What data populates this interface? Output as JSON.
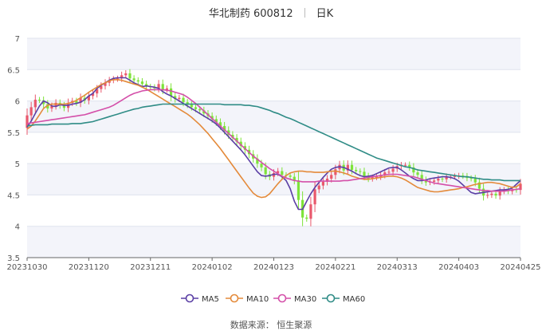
{
  "title": {
    "name": "华北制药 600812",
    "period": "日K"
  },
  "source": "数据来源： 恒生聚源",
  "colors": {
    "up": "#e9586c",
    "down": "#7ee33a",
    "MA5": "#5b3fa5",
    "MA10": "#e48a3a",
    "MA30": "#d44fa9",
    "MA60": "#2f8c86",
    "band": "#f3f4fa",
    "grid": "#dfe3ee"
  },
  "chart_data": {
    "type": "candlestick",
    "ylim": [
      3.5,
      7
    ],
    "yticks": [
      "3.5",
      "4",
      "4.5",
      "5",
      "5.5",
      "6",
      "6.5",
      "7"
    ],
    "xtick_labels": [
      "20231030",
      "20231120",
      "20231211",
      "20240102",
      "20240123",
      "20240221",
      "20240313",
      "20240403",
      "20240425"
    ],
    "xtick_index": [
      0,
      15,
      30,
      45,
      60,
      75,
      90,
      105,
      120
    ],
    "legend": [
      "MA5",
      "MA10",
      "MA30",
      "MA60"
    ],
    "legend_position": "bottom",
    "closes": [
      5.77,
      5.9,
      6.02,
      6.01,
      5.95,
      5.88,
      5.92,
      5.97,
      5.93,
      5.89,
      5.97,
      6.0,
      5.97,
      6.05,
      6.01,
      6.08,
      6.12,
      6.19,
      6.24,
      6.29,
      6.33,
      6.35,
      6.36,
      6.41,
      6.44,
      6.36,
      6.33,
      6.31,
      6.27,
      6.23,
      6.22,
      6.2,
      6.27,
      6.18,
      6.2,
      6.08,
      6.03,
      6.05,
      5.98,
      5.94,
      5.9,
      5.87,
      5.85,
      5.8,
      5.76,
      5.71,
      5.66,
      5.6,
      5.53,
      5.46,
      5.41,
      5.35,
      5.28,
      5.22,
      5.15,
      5.08,
      5.0,
      4.94,
      4.83,
      4.79,
      4.85,
      4.88,
      4.82,
      4.81,
      4.79,
      4.73,
      4.42,
      4.14,
      4.12,
      4.35,
      4.59,
      4.65,
      4.71,
      4.76,
      4.82,
      4.91,
      4.98,
      4.89,
      4.98,
      4.9,
      4.88,
      4.87,
      4.8,
      4.76,
      4.78,
      4.79,
      4.82,
      4.86,
      4.87,
      4.92,
      4.96,
      4.98,
      4.98,
      4.94,
      4.86,
      4.82,
      4.74,
      4.7,
      4.71,
      4.73,
      4.76,
      4.75,
      4.79,
      4.79,
      4.8,
      4.81,
      4.8,
      4.77,
      4.76,
      4.7,
      4.6,
      4.49,
      4.5,
      4.52,
      4.49,
      4.56,
      4.58,
      4.56,
      4.59,
      4.58,
      4.68
    ],
    "ma_series": [
      {
        "name": "MA5",
        "values": [
          5.58,
          5.68,
          5.8,
          5.92,
          6.0,
          5.97,
          5.92,
          5.91,
          5.94,
          5.93,
          5.93,
          5.95,
          5.96,
          5.98,
          6.02,
          6.08,
          6.12,
          6.2,
          6.25,
          6.29,
          6.33,
          6.36,
          6.37,
          6.37,
          6.37,
          6.33,
          6.29,
          6.26,
          6.23,
          6.24,
          6.23,
          6.22,
          6.2,
          6.15,
          6.11,
          6.08,
          6.04,
          6.0,
          5.96,
          5.92,
          5.88,
          5.84,
          5.8,
          5.76,
          5.72,
          5.68,
          5.63,
          5.57,
          5.5,
          5.43,
          5.36,
          5.29,
          5.22,
          5.14,
          5.05,
          4.96,
          4.87,
          4.81,
          4.8,
          4.81,
          4.83,
          4.83,
          4.79,
          4.73,
          4.6,
          4.4,
          4.27,
          4.27,
          4.4,
          4.52,
          4.62,
          4.7,
          4.78,
          4.85,
          4.91,
          4.94,
          4.95,
          4.94,
          4.91,
          4.88,
          4.84,
          4.81,
          4.79,
          4.8,
          4.81,
          4.84,
          4.87,
          4.9,
          4.93,
          4.94,
          4.94,
          4.9,
          4.85,
          4.8,
          4.76,
          4.73,
          4.73,
          4.74,
          4.76,
          4.77,
          4.78,
          4.79,
          4.79,
          4.78,
          4.76,
          4.72,
          4.66,
          4.6,
          4.54,
          4.52,
          4.53,
          4.54,
          4.55,
          4.56,
          4.57,
          4.58,
          4.58,
          4.59,
          4.61,
          4.67,
          4.73
        ]
      },
      {
        "name": "MA10",
        "values": [
          5.55,
          5.6,
          5.68,
          5.78,
          5.88,
          5.93,
          5.95,
          5.95,
          5.95,
          5.95,
          5.96,
          5.98,
          6.01,
          6.05,
          6.09,
          6.14,
          6.18,
          6.22,
          6.26,
          6.29,
          6.32,
          6.34,
          6.34,
          6.33,
          6.31,
          6.29,
          6.27,
          6.25,
          6.22,
          6.19,
          6.15,
          6.11,
          6.07,
          6.03,
          5.99,
          5.95,
          5.91,
          5.87,
          5.83,
          5.79,
          5.74,
          5.68,
          5.62,
          5.55,
          5.48,
          5.4,
          5.32,
          5.24,
          5.15,
          5.06,
          4.97,
          4.88,
          4.79,
          4.7,
          4.61,
          4.53,
          4.48,
          4.46,
          4.47,
          4.52,
          4.6,
          4.68,
          4.75,
          4.81,
          4.85,
          4.87,
          4.88,
          4.88,
          4.87,
          4.87,
          4.86,
          4.86,
          4.86,
          4.87,
          4.88,
          4.88,
          4.87,
          4.85,
          4.83,
          4.8,
          4.78,
          4.76,
          4.75,
          4.75,
          4.76,
          4.77,
          4.78,
          4.79,
          4.8,
          4.8,
          4.79,
          4.77,
          4.74,
          4.7,
          4.66,
          4.62,
          4.6,
          4.58,
          4.56,
          4.55,
          4.55,
          4.56,
          4.57,
          4.58,
          4.59,
          4.6,
          4.62,
          4.63,
          4.65,
          4.67,
          4.68,
          4.69,
          4.7,
          4.7,
          4.69,
          4.68,
          4.66,
          4.64,
          4.62,
          4.63,
          4.68
        ]
      },
      {
        "name": "MA30",
        "values": [
          5.64,
          5.65,
          5.66,
          5.67,
          5.68,
          5.69,
          5.7,
          5.71,
          5.72,
          5.73,
          5.74,
          5.75,
          5.76,
          5.77,
          5.78,
          5.8,
          5.82,
          5.84,
          5.86,
          5.88,
          5.9,
          5.93,
          5.97,
          6.01,
          6.05,
          6.09,
          6.12,
          6.14,
          6.16,
          6.17,
          6.18,
          6.18,
          6.18,
          6.18,
          6.17,
          6.16,
          6.14,
          6.12,
          6.1,
          6.06,
          6.01,
          5.96,
          5.9,
          5.84,
          5.78,
          5.72,
          5.66,
          5.6,
          5.54,
          5.48,
          5.42,
          5.36,
          5.3,
          5.24,
          5.18,
          5.12,
          5.07,
          5.02,
          4.97,
          4.92,
          4.88,
          4.84,
          4.8,
          4.77,
          4.75,
          4.73,
          4.72,
          4.71,
          4.71,
          4.71,
          4.71,
          4.72,
          4.72,
          4.72,
          4.72,
          4.72,
          4.72,
          4.73,
          4.73,
          4.74,
          4.75,
          4.76,
          4.77,
          4.78,
          4.79,
          4.8,
          4.81,
          4.82,
          4.83,
          4.83,
          4.83,
          4.82,
          4.81,
          4.8,
          4.79,
          4.77,
          4.75,
          4.73,
          4.71,
          4.69,
          4.68,
          4.67,
          4.66,
          4.65,
          4.64,
          4.63,
          4.62,
          4.61,
          4.6,
          4.59,
          4.58,
          4.57,
          4.57,
          4.56,
          4.56,
          4.56,
          4.56,
          4.57,
          4.58,
          4.59,
          4.6
        ]
      },
      {
        "name": "MA60",
        "values": [
          5.6,
          5.61,
          5.62,
          5.62,
          5.62,
          5.62,
          5.63,
          5.63,
          5.63,
          5.63,
          5.63,
          5.64,
          5.64,
          5.64,
          5.65,
          5.66,
          5.67,
          5.69,
          5.71,
          5.73,
          5.75,
          5.77,
          5.79,
          5.81,
          5.83,
          5.85,
          5.87,
          5.88,
          5.9,
          5.91,
          5.92,
          5.93,
          5.94,
          5.95,
          5.95,
          5.95,
          5.95,
          5.95,
          5.95,
          5.95,
          5.95,
          5.95,
          5.95,
          5.95,
          5.95,
          5.95,
          5.95,
          5.95,
          5.94,
          5.94,
          5.94,
          5.94,
          5.94,
          5.93,
          5.93,
          5.92,
          5.91,
          5.89,
          5.87,
          5.85,
          5.82,
          5.8,
          5.77,
          5.74,
          5.72,
          5.69,
          5.66,
          5.63,
          5.6,
          5.57,
          5.54,
          5.51,
          5.48,
          5.45,
          5.42,
          5.39,
          5.36,
          5.33,
          5.3,
          5.27,
          5.24,
          5.21,
          5.18,
          5.15,
          5.12,
          5.09,
          5.07,
          5.05,
          5.03,
          5.01,
          4.99,
          4.97,
          4.95,
          4.94,
          4.92,
          4.9,
          4.89,
          4.88,
          4.87,
          4.86,
          4.85,
          4.84,
          4.83,
          4.82,
          4.81,
          4.8,
          4.79,
          4.79,
          4.78,
          4.77,
          4.76,
          4.75,
          4.75,
          4.74,
          4.74,
          4.74,
          4.73,
          4.73,
          4.73,
          4.73,
          4.73
        ]
      }
    ]
  }
}
